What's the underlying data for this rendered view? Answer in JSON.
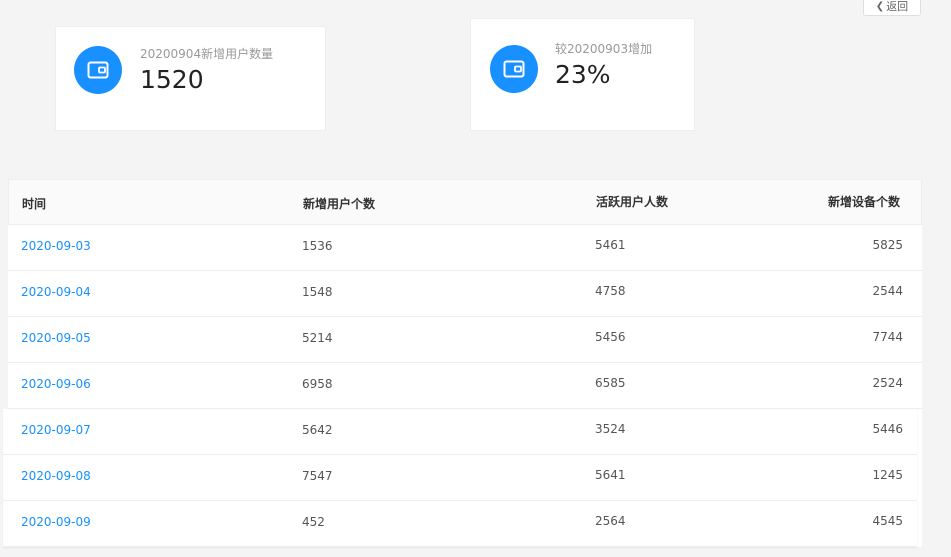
{
  "header": {
    "back_label": "返回"
  },
  "cards": [
    {
      "label": "20200904新增用户数量",
      "value": "1520",
      "icon": "wallet-icon",
      "color": "#1890ff"
    },
    {
      "label": "较20200903增加",
      "value": "23%",
      "icon": "wallet-icon",
      "color": "#1890ff"
    }
  ],
  "table": {
    "columns": [
      "时间",
      "新增用户个数",
      "活跃用户人数",
      "新增设备个数"
    ],
    "rows": [
      {
        "date": "2020-09-03",
        "new_users": "1536",
        "active_users": "5461",
        "new_devices": "5825"
      },
      {
        "date": "2020-09-04",
        "new_users": "1548",
        "active_users": "4758",
        "new_devices": "2544"
      },
      {
        "date": "2020-09-05",
        "new_users": "5214",
        "active_users": "5456",
        "new_devices": "7744"
      },
      {
        "date": "2020-09-06",
        "new_users": "6958",
        "active_users": "6585",
        "new_devices": "2524"
      },
      {
        "date": "2020-09-07",
        "new_users": "5642",
        "active_users": "3524",
        "new_devices": "5446"
      },
      {
        "date": "2020-09-08",
        "new_users": "7547",
        "active_users": "5641",
        "new_devices": "1245"
      },
      {
        "date": "2020-09-09",
        "new_users": "452",
        "active_users": "2564",
        "new_devices": "4545"
      }
    ]
  }
}
